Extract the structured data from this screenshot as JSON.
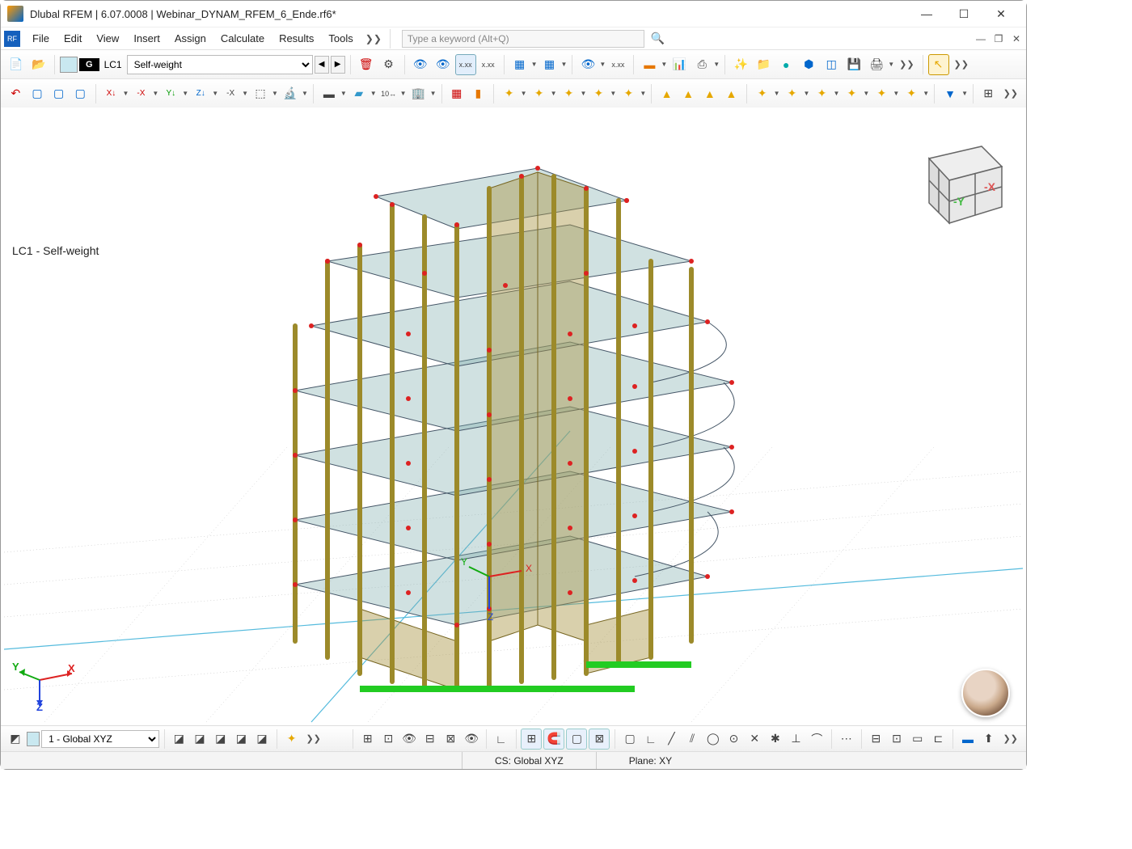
{
  "titlebar": {
    "title": "Dlubal RFEM | 6.07.0008 | Webinar_DYNAM_RFEM_6_Ende.rf6*"
  },
  "menu": {
    "items": [
      "File",
      "Edit",
      "View",
      "Insert",
      "Assign",
      "Calculate",
      "Results",
      "Tools"
    ],
    "search_placeholder": "Type a keyword (Alt+Q)"
  },
  "toolbar1": {
    "lc_badge": "G",
    "lc_code": "LC1",
    "lc_select": "Self-weight"
  },
  "viewport": {
    "label": "LC1 - Self-weight"
  },
  "navcube": {
    "y_label": "-Y",
    "x_label": "-X"
  },
  "axis": {
    "x": "X",
    "y": "Y",
    "z": "Z"
  },
  "workplane": {
    "select": "1 - Global XYZ"
  },
  "status": {
    "cs": "CS: Global XYZ",
    "plane": "Plane: XY"
  }
}
